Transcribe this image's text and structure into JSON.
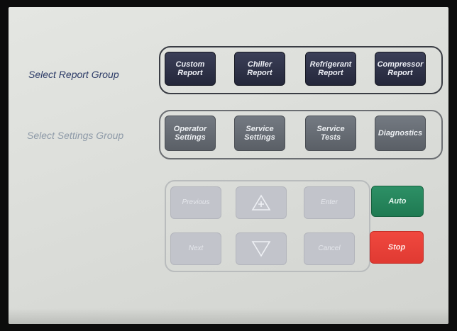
{
  "report_group": {
    "label": "Select Report Group",
    "buttons": [
      "Custom\nReport",
      "Chiller\nReport",
      "Refrigerant\nReport",
      "Compressor\nReport"
    ]
  },
  "settings_group": {
    "label": "Select Settings Group",
    "buttons": [
      "Operator\nSettings",
      "Service\nSettings",
      "Service\nTests",
      "Diagnostics"
    ]
  },
  "navigation": {
    "previous": "Previous",
    "next": "Next",
    "up_icon": "up-arrow-plus-icon",
    "down_icon": "down-arrow-icon",
    "enter": "Enter",
    "cancel": "Cancel"
  },
  "control": {
    "auto": "Auto",
    "stop": "Stop"
  },
  "colors": {
    "report_button": "#2a2d40",
    "settings_button": "#62676e",
    "nav_button": "#c2c4cb",
    "auto_button": "#26865c",
    "stop_button": "#e8413a"
  }
}
